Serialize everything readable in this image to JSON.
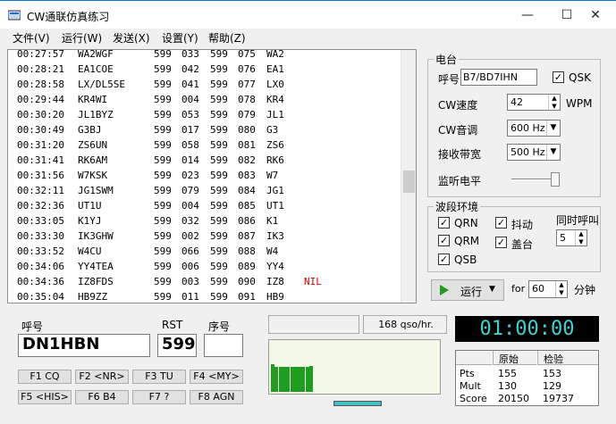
{
  "window": {
    "title": "CW通联仿真练习"
  },
  "menu": [
    "文件(V)",
    "运行(W)",
    "发送(X)",
    "设置(Y)",
    "帮助(Z)"
  ],
  "log": [
    {
      "time": "00:27:57",
      "call": "WA2WGF",
      "rst1": "599",
      "n1": "033",
      "rst2": "599",
      "n2": "075",
      "pfx": "WA2",
      "note": ""
    },
    {
      "time": "00:28:21",
      "call": "EA1COE",
      "rst1": "599",
      "n1": "042",
      "rst2": "599",
      "n2": "076",
      "pfx": "EA1",
      "note": ""
    },
    {
      "time": "00:28:58",
      "call": "LX/DL5SE",
      "rst1": "599",
      "n1": "041",
      "rst2": "599",
      "n2": "077",
      "pfx": "LX0",
      "note": ""
    },
    {
      "time": "00:29:44",
      "call": "KR4WI",
      "rst1": "599",
      "n1": "004",
      "rst2": "599",
      "n2": "078",
      "pfx": "KR4",
      "note": ""
    },
    {
      "time": "00:30:20",
      "call": "JL1BYZ",
      "rst1": "599",
      "n1": "053",
      "rst2": "599",
      "n2": "079",
      "pfx": "JL1",
      "note": ""
    },
    {
      "time": "00:30:49",
      "call": "G3BJ",
      "rst1": "599",
      "n1": "017",
      "rst2": "599",
      "n2": "080",
      "pfx": "G3",
      "note": ""
    },
    {
      "time": "00:31:20",
      "call": "ZS6UN",
      "rst1": "599",
      "n1": "058",
      "rst2": "599",
      "n2": "081",
      "pfx": "ZS6",
      "note": ""
    },
    {
      "time": "00:31:41",
      "call": "RK6AM",
      "rst1": "599",
      "n1": "014",
      "rst2": "599",
      "n2": "082",
      "pfx": "RK6",
      "note": ""
    },
    {
      "time": "00:31:56",
      "call": "W7KSK",
      "rst1": "599",
      "n1": "023",
      "rst2": "599",
      "n2": "083",
      "pfx": "W7",
      "note": ""
    },
    {
      "time": "00:32:11",
      "call": "JG1SWM",
      "rst1": "599",
      "n1": "079",
      "rst2": "599",
      "n2": "084",
      "pfx": "JG1",
      "note": ""
    },
    {
      "time": "00:32:36",
      "call": "UT1U",
      "rst1": "599",
      "n1": "004",
      "rst2": "599",
      "n2": "085",
      "pfx": "UT1",
      "note": ""
    },
    {
      "time": "00:33:05",
      "call": "K1YJ",
      "rst1": "599",
      "n1": "032",
      "rst2": "599",
      "n2": "086",
      "pfx": "K1",
      "note": ""
    },
    {
      "time": "00:33:30",
      "call": "IK3GHW",
      "rst1": "599",
      "n1": "002",
      "rst2": "599",
      "n2": "087",
      "pfx": "IK3",
      "note": ""
    },
    {
      "time": "00:33:52",
      "call": "W4CU",
      "rst1": "599",
      "n1": "066",
      "rst2": "599",
      "n2": "088",
      "pfx": "W4",
      "note": ""
    },
    {
      "time": "00:34:06",
      "call": "YY4TEA",
      "rst1": "599",
      "n1": "006",
      "rst2": "599",
      "n2": "089",
      "pfx": "YY4",
      "note": ""
    },
    {
      "time": "00:34:36",
      "call": "IZ8FDS",
      "rst1": "599",
      "n1": "003",
      "rst2": "599",
      "n2": "090",
      "pfx": "IZ8",
      "note": "NIL"
    },
    {
      "time": "00:35:04",
      "call": "HB9ZZ",
      "rst1": "599",
      "n1": "011",
      "rst2": "599",
      "n2": "091",
      "pfx": "HB9",
      "note": ""
    }
  ],
  "station": {
    "title": "电台",
    "call_label": "呼号",
    "call_value": "B7/BD7IHN",
    "qsk_label": "QSK",
    "speed_label": "CW速度",
    "speed_value": "42",
    "speed_unit": "WPM",
    "pitch_label": "CW音调",
    "pitch_value": "600 Hz",
    "bw_label": "接收带宽",
    "bw_value": "500 Hz",
    "monitor_label": "监听电平"
  },
  "band": {
    "title": "波段环境",
    "qrn": "QRN",
    "qrm": "QRM",
    "qsb": "QSB",
    "flutter": "抖动",
    "lids": "盖台",
    "simul_label": "同时呼叫",
    "simul_value": "5"
  },
  "run": {
    "label": "运行",
    "for_label": "for",
    "minutes": "60",
    "unit": "分钟"
  },
  "entry": {
    "call_label": "呼号",
    "call_value": "DN1HBN",
    "rst_label": "RST",
    "rst_value": "599",
    "nr_label": "序号",
    "nr_value": ""
  },
  "fkeys": [
    "F1 CQ",
    "F2 <NR>",
    "F3 TU",
    "F4 <MY>",
    "F5 <HIS>",
    "F6 B4",
    "F7 ?",
    "F8 AGN"
  ],
  "rate": "168 qso/hr.",
  "clock": "01:00:00",
  "score": {
    "headers": [
      "",
      "原始",
      "检验"
    ],
    "rows": [
      {
        "label": "Pts",
        "raw": "155",
        "checked": "153"
      },
      {
        "label": "Mult",
        "raw": "130",
        "checked": "129"
      },
      {
        "label": "Score",
        "raw": "20150",
        "checked": "19737"
      }
    ]
  },
  "meter_levels": [
    0.55,
    0.5,
    0.5,
    0.5,
    0.5,
    0.5,
    0.5,
    0.5,
    0.5,
    0.5,
    0.52
  ]
}
